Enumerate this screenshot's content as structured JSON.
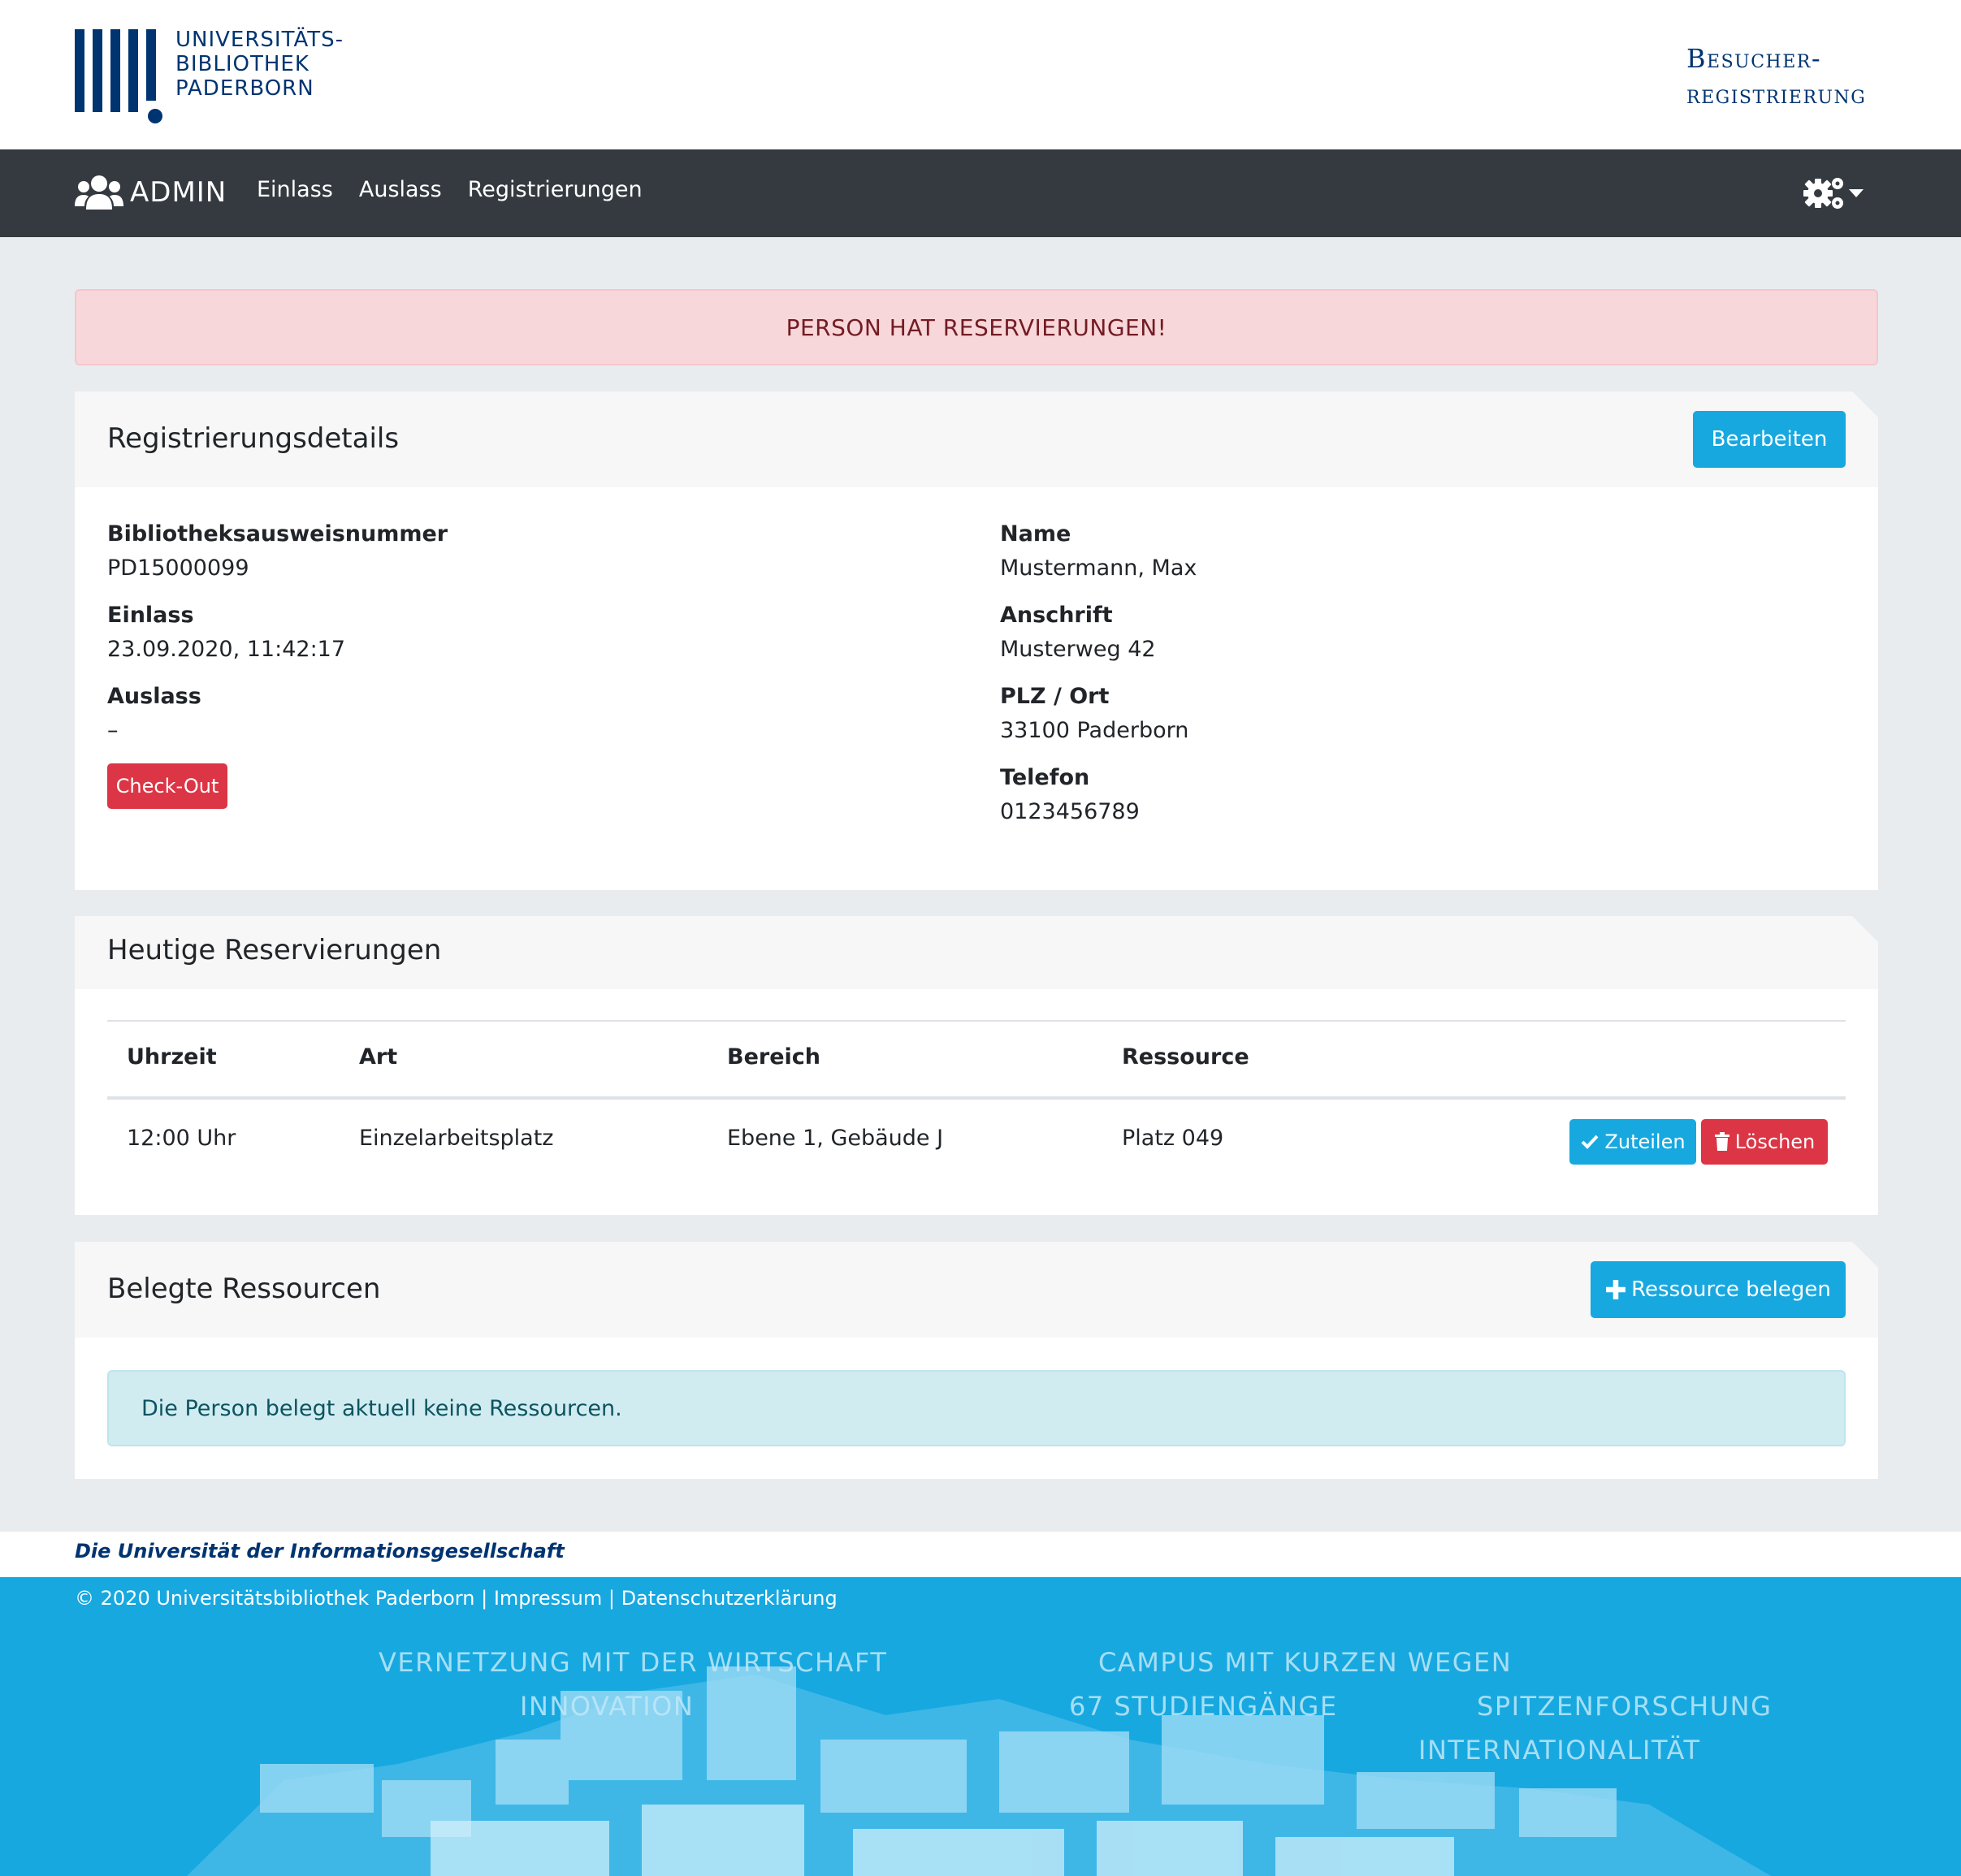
{
  "logo": {
    "lines": [
      "UNIVERSITÄTS-",
      "BIBLIOTHEK",
      "PADERBORN"
    ]
  },
  "app_title": {
    "line1": "Besucher-",
    "line2": "registrierung"
  },
  "navbar": {
    "brand": "ADMIN",
    "brand_icon": "users-icon",
    "links": [
      "Einlass",
      "Auslass",
      "Registrierungen"
    ],
    "settings_icon": "gears-icon"
  },
  "alert": {
    "message": "PERSON HAT RESERVIERUNGEN!"
  },
  "details": {
    "title": "Registrierungsdetails",
    "edit_button": "Bearbeiten",
    "card_number_label": "Bibliotheksausweisnummer",
    "card_number": "PD15000099",
    "entry_label": "Einlass",
    "entry": "23.09.2020, 11:42:17",
    "exit_label": "Auslass",
    "exit": "–",
    "checkout_button": "Check-Out",
    "name_label": "Name",
    "name": "Mustermann, Max",
    "address_label": "Anschrift",
    "address": "Musterweg 42",
    "city_label": "PLZ / Ort",
    "city": "33100 Paderborn",
    "phone_label": "Telefon",
    "phone": "0123456789"
  },
  "reservations": {
    "title": "Heutige Reservierungen",
    "columns": [
      "Uhrzeit",
      "Art",
      "Bereich",
      "Ressource"
    ],
    "rows": [
      {
        "time": "12:00 Uhr",
        "type": "Einzelarbeitsplatz",
        "area": "Ebene 1, Gebäude J",
        "resource": "Platz 049",
        "assign_button": "Zuteilen",
        "delete_button": "Löschen"
      }
    ]
  },
  "resources": {
    "title": "Belegte Ressourcen",
    "add_button": "Ressource belegen",
    "empty_message": "Die Person belegt aktuell keine Ressourcen."
  },
  "footer": {
    "tagline": "Die Universität der Informationsgesellschaft",
    "copyright": "© 2020 Universitätsbibliothek Paderborn",
    "separator": "|",
    "impressum": "Impressum",
    "privacy": "Datenschutzerklärung",
    "claims": [
      "VERNETZUNG MIT DER WIRTSCHAFT",
      "INNOVATION",
      "CAMPUS MIT KURZEN WEGEN",
      "67 STUDIENGÄNGE",
      "SPITZENFORSCHUNG",
      "INTERNATIONALITÄT"
    ]
  },
  "colors": {
    "brand_blue": "#003471",
    "navbar": "#343a40",
    "info": "#17a8e0",
    "danger": "#dc3545",
    "alert_danger_bg": "#f8d7da",
    "alert_info_bg": "#d1ecf1"
  }
}
